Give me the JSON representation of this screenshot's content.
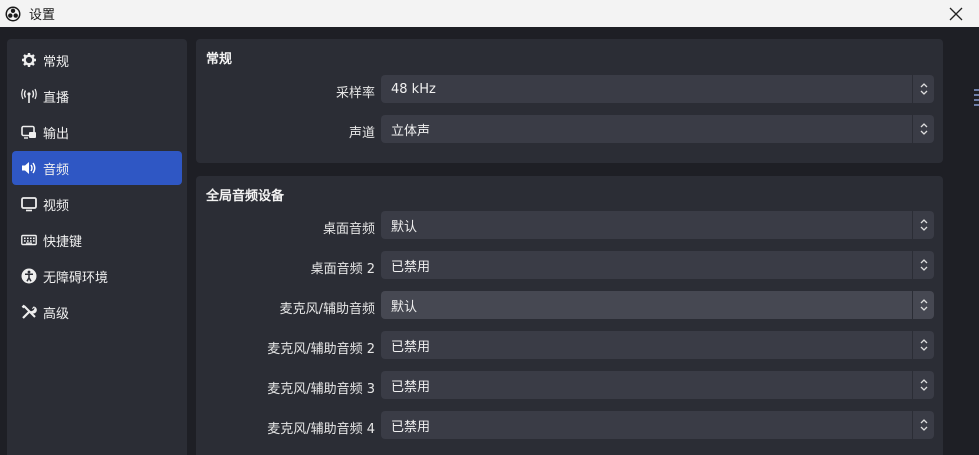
{
  "window": {
    "title": "设置"
  },
  "sidebar": {
    "items": [
      {
        "label": "常规",
        "icon": "gear-icon"
      },
      {
        "label": "直播",
        "icon": "antenna-icon"
      },
      {
        "label": "输出",
        "icon": "output-icon"
      },
      {
        "label": "音频",
        "icon": "speaker-icon",
        "active": true
      },
      {
        "label": "视频",
        "icon": "monitor-icon"
      },
      {
        "label": "快捷键",
        "icon": "keyboard-icon"
      },
      {
        "label": "无障碍环境",
        "icon": "accessibility-icon"
      },
      {
        "label": "高级",
        "icon": "tools-icon"
      }
    ]
  },
  "general": {
    "title": "常规",
    "sample_rate": {
      "label": "采样率",
      "value": "48 kHz"
    },
    "channels": {
      "label": "声道",
      "value": "立体声"
    }
  },
  "global_audio": {
    "title": "全局音频设备",
    "rows": [
      {
        "label": "桌面音频",
        "value": "默认"
      },
      {
        "label": "桌面音频 2",
        "value": "已禁用"
      },
      {
        "label": "麦克风/辅助音频",
        "value": "默认"
      },
      {
        "label": "麦克风/辅助音频 2",
        "value": "已禁用"
      },
      {
        "label": "麦克风/辅助音频 3",
        "value": "已禁用"
      },
      {
        "label": "麦克风/辅助音频 4",
        "value": "已禁用"
      }
    ]
  },
  "colors": {
    "accent": "#2f57c4",
    "panel": "#2b2d35",
    "background": "#1e1f25",
    "field": "#3a3c46"
  }
}
